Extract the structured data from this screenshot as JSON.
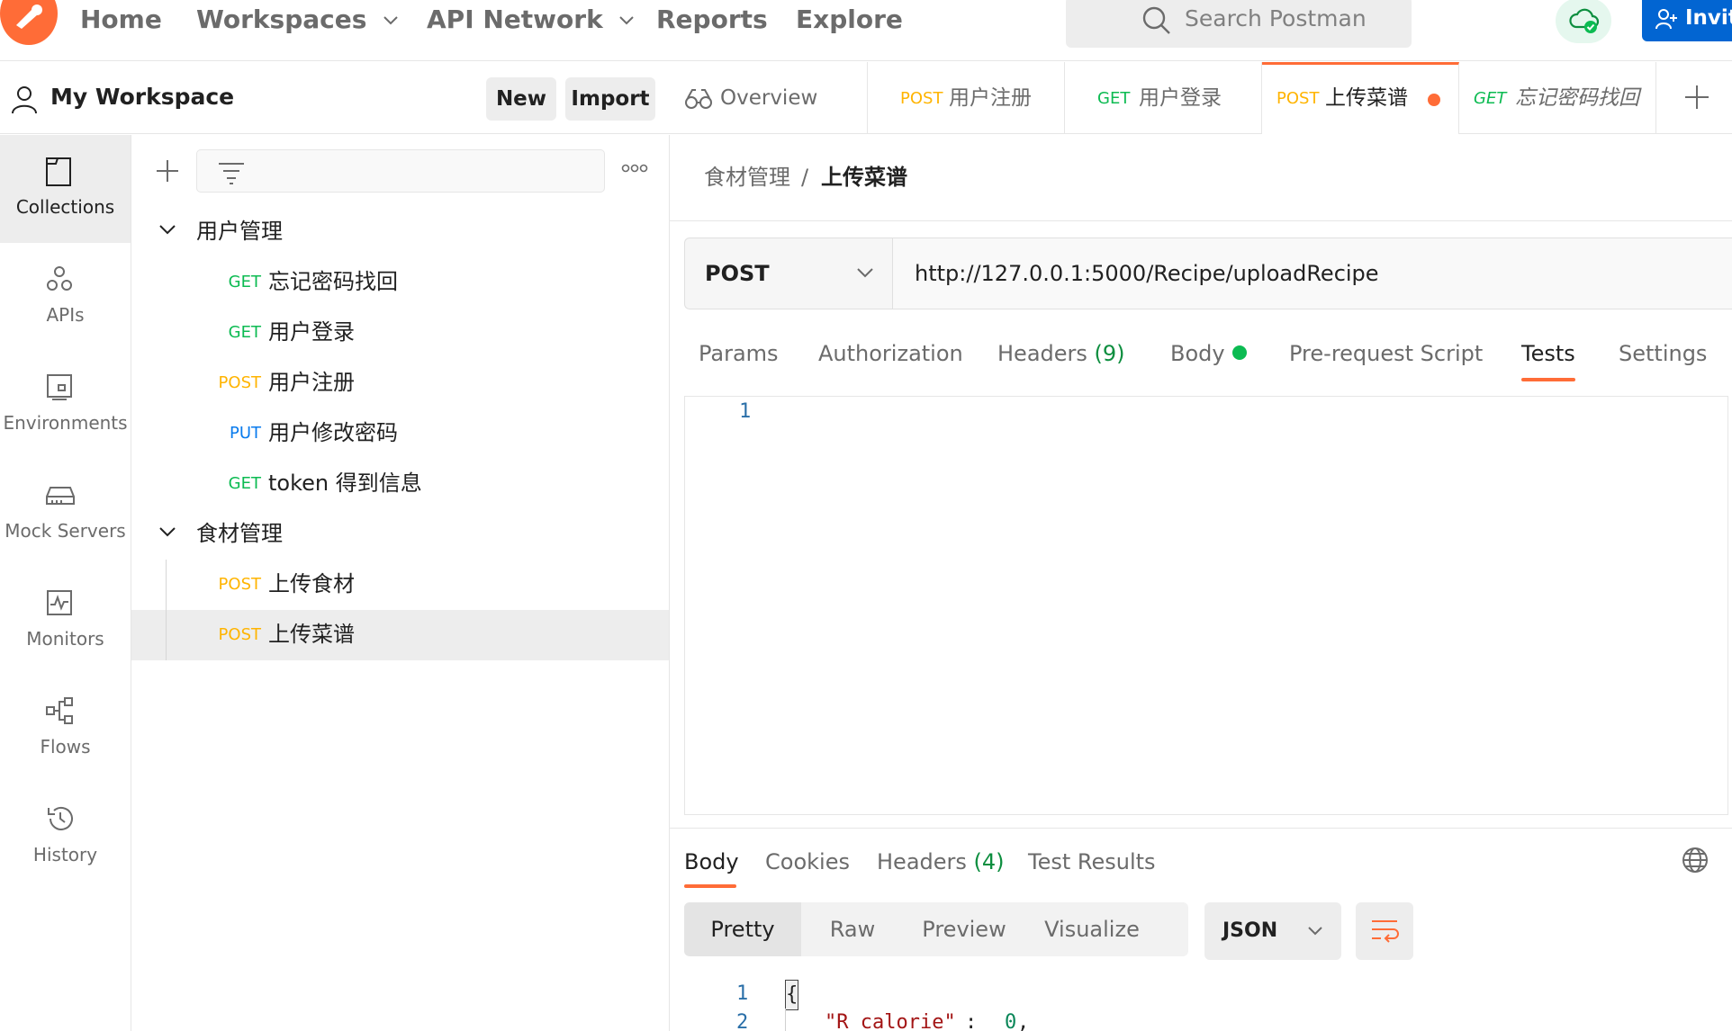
{
  "topnav": {
    "home": "Home",
    "workspaces": "Workspaces",
    "api_network": "API Network",
    "reports": "Reports",
    "explore": "Explore",
    "search_placeholder": "Search Postman",
    "invite": "Invite"
  },
  "workspace": {
    "title": "My Workspace",
    "new_label": "New",
    "import_label": "Import"
  },
  "iconbar": [
    {
      "label": "Collections",
      "icon": "collections-icon"
    },
    {
      "label": "APIs",
      "icon": "apis-icon"
    },
    {
      "label": "Environments",
      "icon": "environments-icon"
    },
    {
      "label": "Mock Servers",
      "icon": "mock-servers-icon"
    },
    {
      "label": "Monitors",
      "icon": "monitors-icon"
    },
    {
      "label": "Flows",
      "icon": "flows-icon"
    },
    {
      "label": "History",
      "icon": "history-icon"
    }
  ],
  "tree": {
    "folders": [
      {
        "name": "用户管理",
        "requests": [
          {
            "method": "GET",
            "name": "忘记密码找回"
          },
          {
            "method": "GET",
            "name": "用户登录"
          },
          {
            "method": "POST",
            "name": "用户注册"
          },
          {
            "method": "PUT",
            "name": "用户修改密码"
          },
          {
            "method": "GET",
            "name": "token 得到信息"
          }
        ]
      },
      {
        "name": "食材管理",
        "requests": [
          {
            "method": "POST",
            "name": "上传食材"
          },
          {
            "method": "POST",
            "name": "上传菜谱"
          }
        ]
      }
    ]
  },
  "tabs": [
    {
      "method": "",
      "name": "Overview"
    },
    {
      "method": "POST",
      "name": "用户注册"
    },
    {
      "method": "GET",
      "name": "用户登录"
    },
    {
      "method": "POST",
      "name": "上传菜谱"
    },
    {
      "method": "GET",
      "name": "忘记密码找回"
    }
  ],
  "breadcrumb": {
    "parent": "食材管理",
    "separator": "/",
    "current": "上传菜谱"
  },
  "request": {
    "method": "POST",
    "url": "http://127.0.0.1:5000/Recipe/uploadRecipe",
    "tabs": {
      "params": "Params",
      "authorization": "Authorization",
      "headers": "Headers",
      "headers_count": "(9)",
      "body": "Body",
      "prerequest": "Pre-request Script",
      "tests": "Tests",
      "settings": "Settings"
    },
    "editor_line": "1"
  },
  "response": {
    "tabs": {
      "body": "Body",
      "cookies": "Cookies",
      "headers": "Headers",
      "headers_count": "(4)",
      "test_results": "Test Results"
    },
    "views": {
      "pretty": "Pretty",
      "raw": "Raw",
      "preview": "Preview",
      "visualize": "Visualize"
    },
    "format": "JSON",
    "code": {
      "line1": "1",
      "line2": "2",
      "brace": "{",
      "key": "\"R_calorie\"",
      "colon": ": ",
      "value": "0",
      "comma": ","
    }
  },
  "colors": {
    "accent": "#ff6c37",
    "get": "#0cbb52",
    "post": "#ffb400",
    "put": "#097bed",
    "invite": "#0265d2",
    "count_green": "#0d8e3f"
  }
}
